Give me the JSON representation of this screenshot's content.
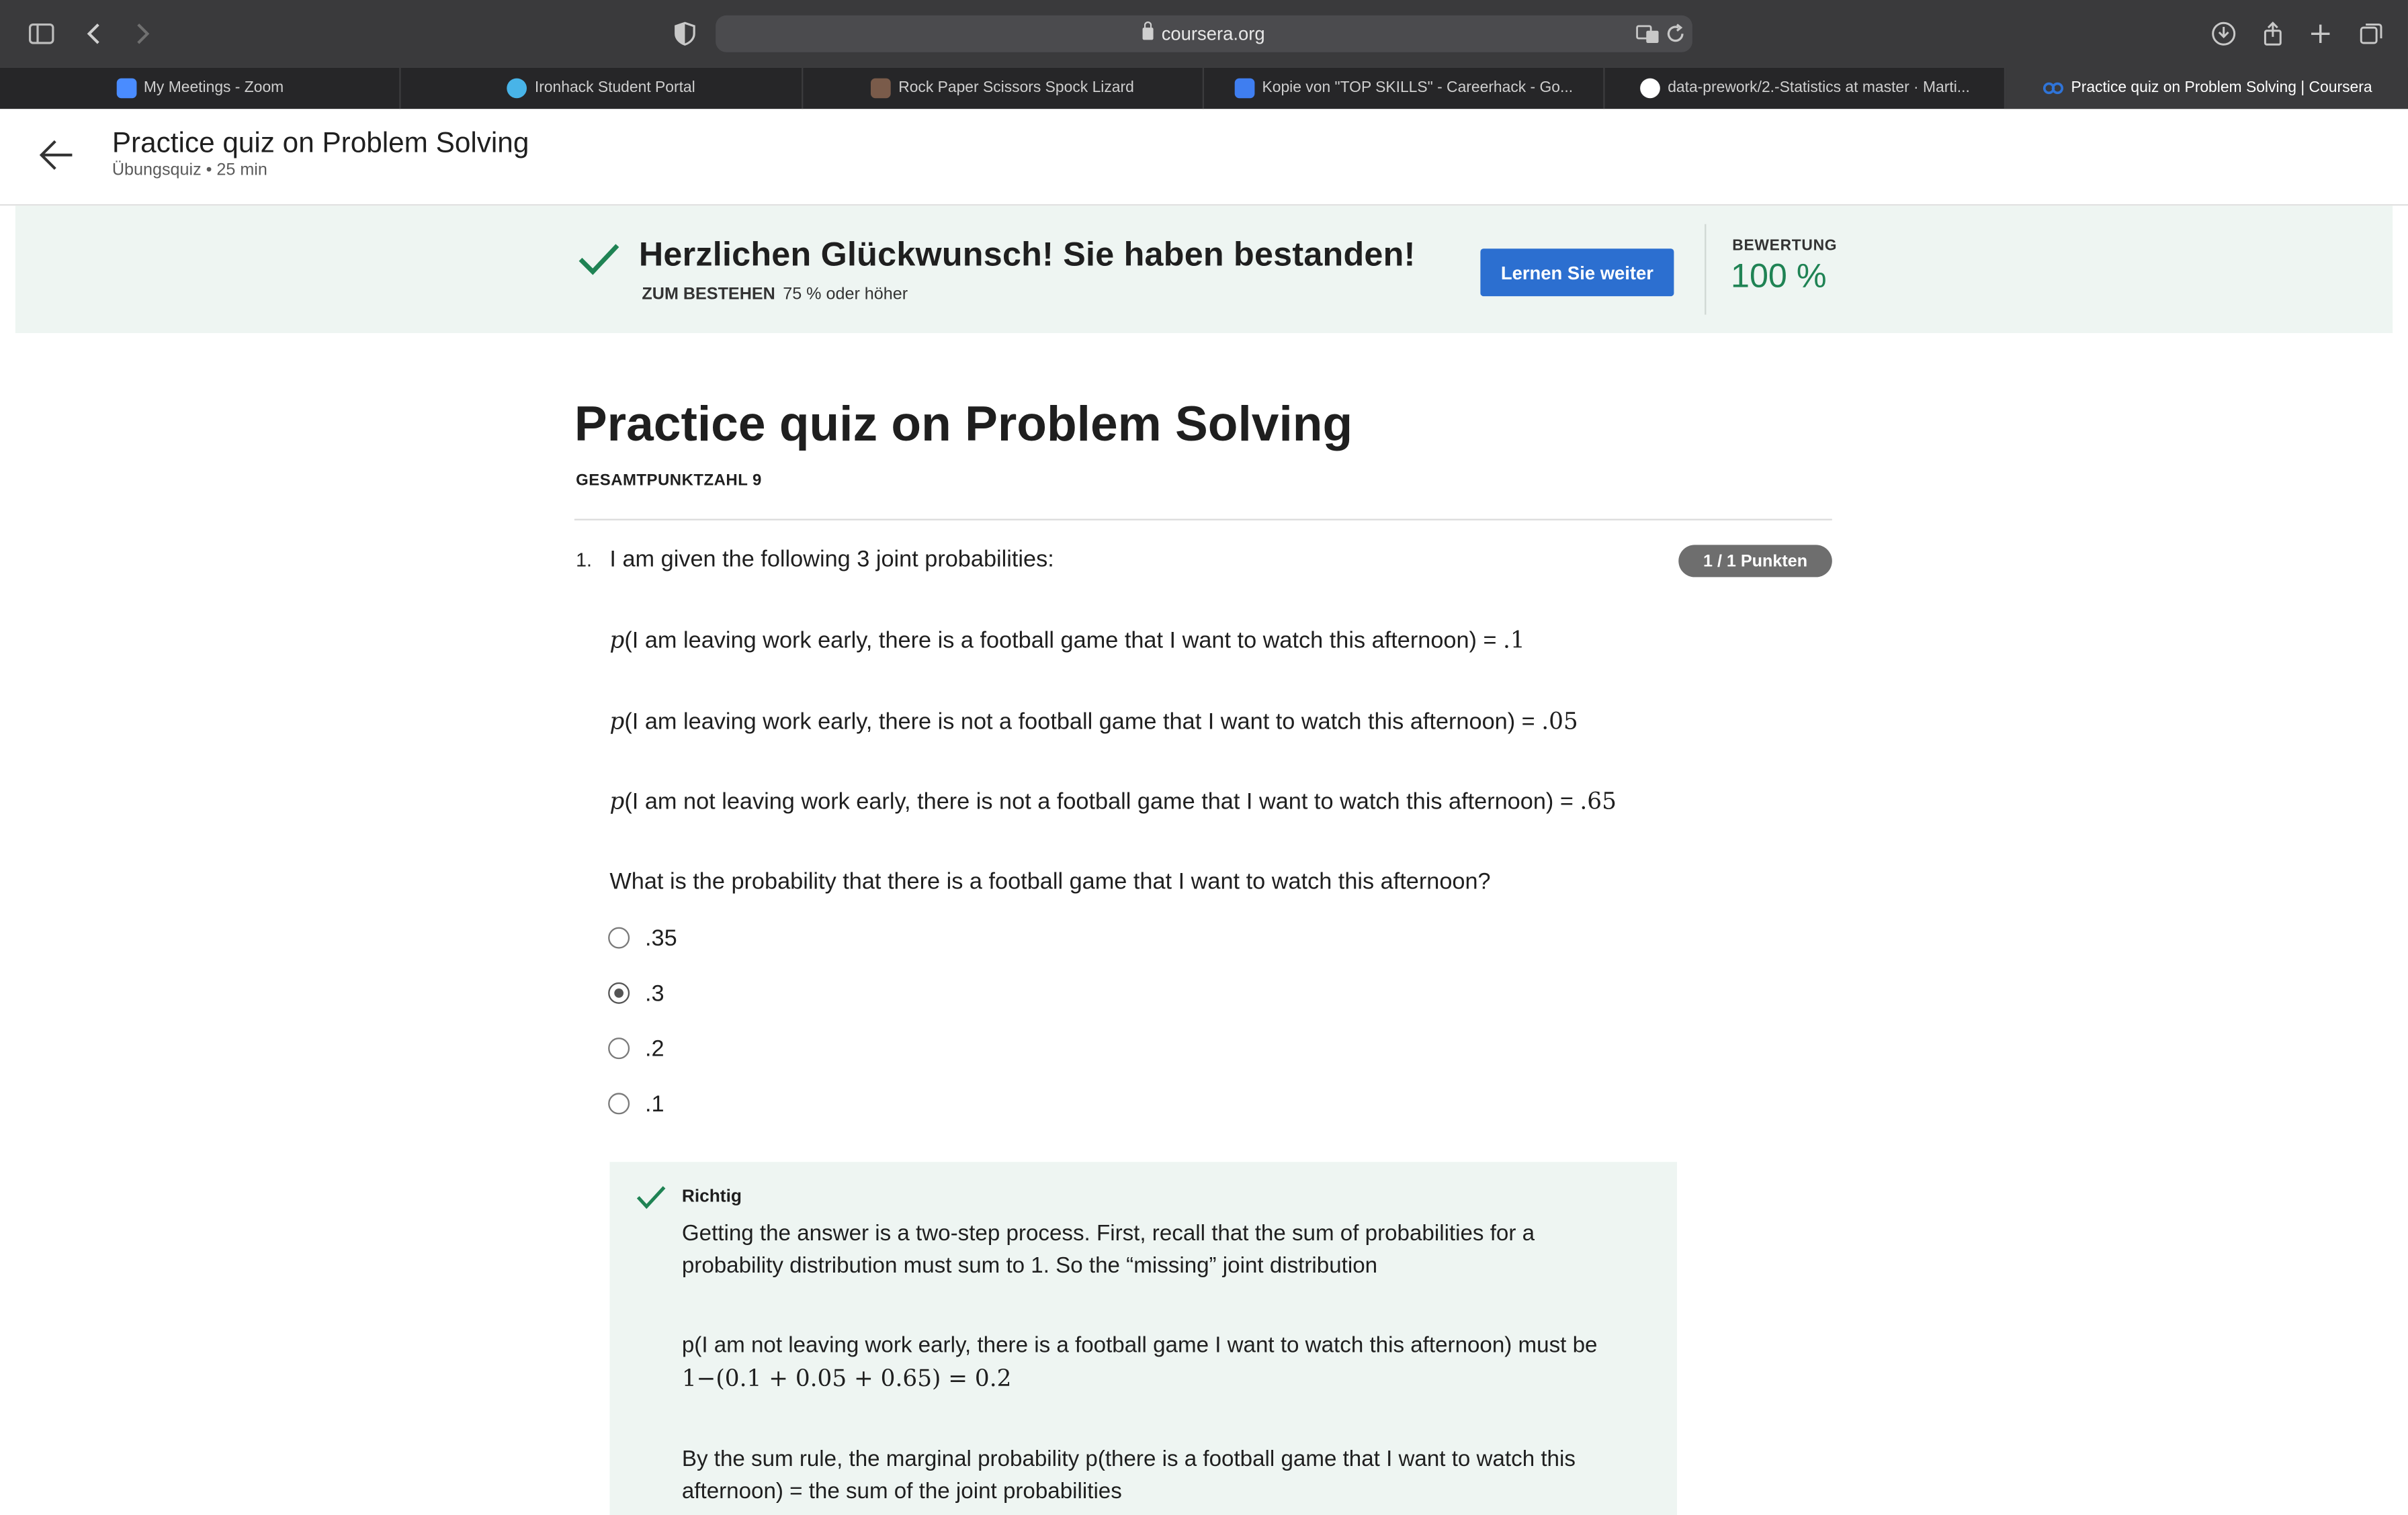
{
  "browser": {
    "url": "coursera.org",
    "tabs": [
      {
        "label": "My Meetings - Zoom",
        "fav_color": "#4a8cff"
      },
      {
        "label": "Ironhack Student Portal",
        "fav_color": "#48b4e8"
      },
      {
        "label": "Rock Paper Scissors Spock Lizard",
        "fav_color": "#7a5b4a"
      },
      {
        "label": "Kopie von \"TOP SKILLS\" - Careerhack - Go...",
        "fav_color": "#3f7ef0"
      },
      {
        "label": "data-prework/2.-Statistics at master · Marti...",
        "fav_color": "#ffffff"
      },
      {
        "label": "Practice quiz on Problem Solving | Coursera",
        "fav_color": "#2f74d8"
      }
    ]
  },
  "header": {
    "title": "Practice quiz on Problem Solving",
    "subtitle": "Übungsquiz • 25 min"
  },
  "banner": {
    "title": "Herzlichen Glückwunsch! Sie haben bestanden!",
    "pass_label": "ZUM BESTEHEN",
    "pass_value": "75 % oder höher",
    "button": "Lernen Sie weiter",
    "score_label": "BEWERTUNG",
    "score": "100 %"
  },
  "quiz": {
    "title": "Practice quiz on Problem Solving",
    "total": "GESAMTPUNKTZAHL 9",
    "question": {
      "number": "1.",
      "text": "I am given the following 3 joint probabilities:",
      "points": "1 / 1 Punkten",
      "probs": [
        {
          "p": "p",
          "text": "(I am leaving work early, there is a football game that I want to watch this afternoon) = ",
          "value": ".1"
        },
        {
          "p": "p",
          "text": "(I am leaving work early, there is not a football game that I want to watch this afternoon) = ",
          "value": ".05"
        },
        {
          "p": "p",
          "text": "(I am not leaving work early, there is not a football game that I want to watch this afternoon) = ",
          "value": ".65"
        }
      ],
      "prompt": "What is the probability that there is a football game that I want to watch this afternoon?",
      "options": [
        ".35",
        ".3",
        ".2",
        ".1"
      ],
      "selected": ".3"
    },
    "feedback": {
      "label": "Richtig",
      "p1": "Getting the answer is a two-step process. First, recall that the sum of probabilities for a probability distribution must sum to 1. So the “missing” joint distribution",
      "p2": "p(I am not leaving work early, there is a football game I want to watch this afternoon) must be",
      "math": "1−(0.1 + 0.05 + 0.65) = 0.2",
      "p3": "By the sum rule, the marginal probability p(there is a football game that I want to watch this afternoon) = the sum of the joint probabilities"
    }
  },
  "colors": {
    "accent": "#2c6fd0",
    "success": "#1f8354",
    "banner_bg": "#eef5f2"
  }
}
